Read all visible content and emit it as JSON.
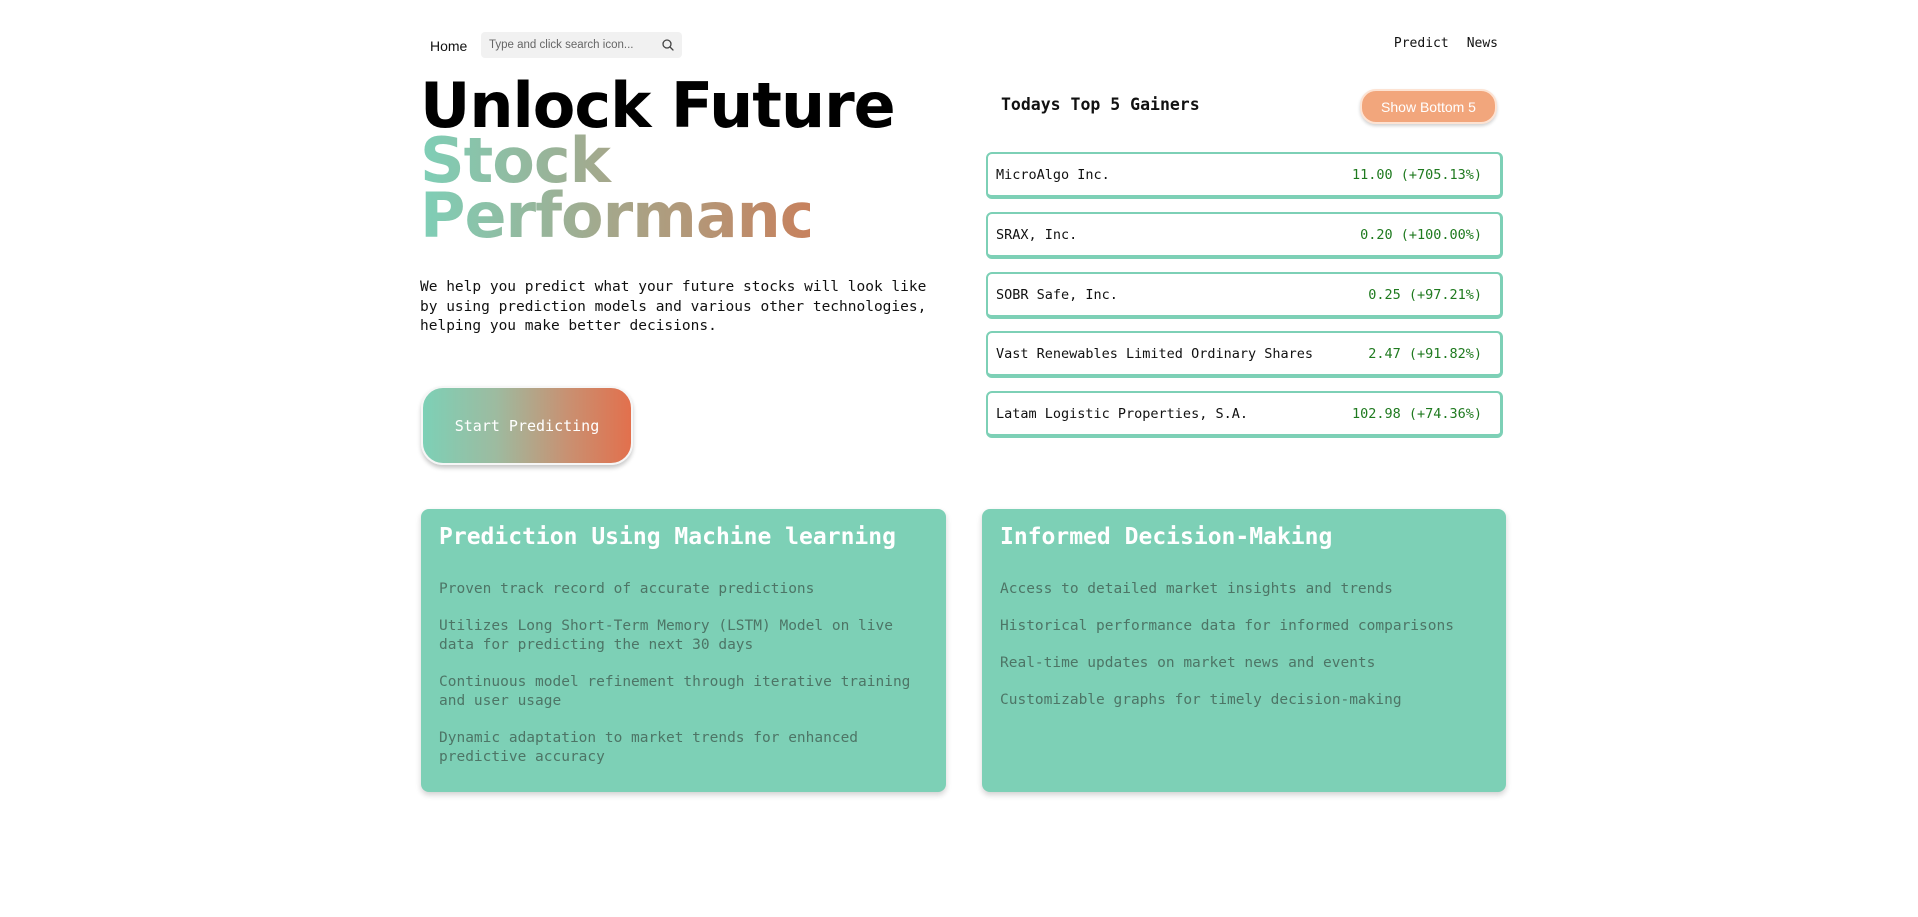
{
  "nav": {
    "home_label": "Home",
    "search_placeholder": "Type and click search icon...",
    "predict_label": "Predict",
    "news_label": "News"
  },
  "hero": {
    "title_line1": "Unlock Future",
    "title_line2": "Stock",
    "title_line3": "Performance",
    "description": "We help you predict what your future stocks will look like by using prediction models and various other technologies, helping you make better decisions.",
    "cta_label": "Start Predicting"
  },
  "gainers": {
    "title": "Todays Top 5 Gainers",
    "toggle_label": "Show Bottom 5",
    "items": [
      {
        "name": "MicroAlgo Inc.",
        "value": "11.00 (+705.13%)"
      },
      {
        "name": "SRAX, Inc.",
        "value": "0.20 (+100.00%)"
      },
      {
        "name": "SOBR Safe, Inc.",
        "value": "0.25 (+97.21%)"
      },
      {
        "name": "Vast Renewables Limited Ordinary Shares",
        "value": "2.47 (+91.82%)"
      },
      {
        "name": "Latam Logistic Properties, S.A.",
        "value": "102.98 (+74.36%)"
      }
    ]
  },
  "features": {
    "ml": {
      "title": "Prediction Using Machine learning",
      "points": [
        "Proven track record of accurate predictions",
        "Utilizes Long Short-Term Memory (LSTM) Model on live data for predicting the next 30 days",
        "Continuous model refinement through iterative training and user usage",
        "Dynamic adaptation to market trends for enhanced predictive accuracy"
      ]
    },
    "decision": {
      "title": "Informed Decision-Making",
      "points": [
        "Access to detailed market insights and trends",
        "Historical performance data for informed comparisons",
        "Real-time updates on market news and events",
        "Customizable graphs for timely decision-making"
      ]
    }
  },
  "colors": {
    "accent": "#7dd0b6",
    "toggle": "#f2a67c",
    "gain": "#1f7a1f"
  },
  "icons": {
    "search": "search-icon"
  }
}
